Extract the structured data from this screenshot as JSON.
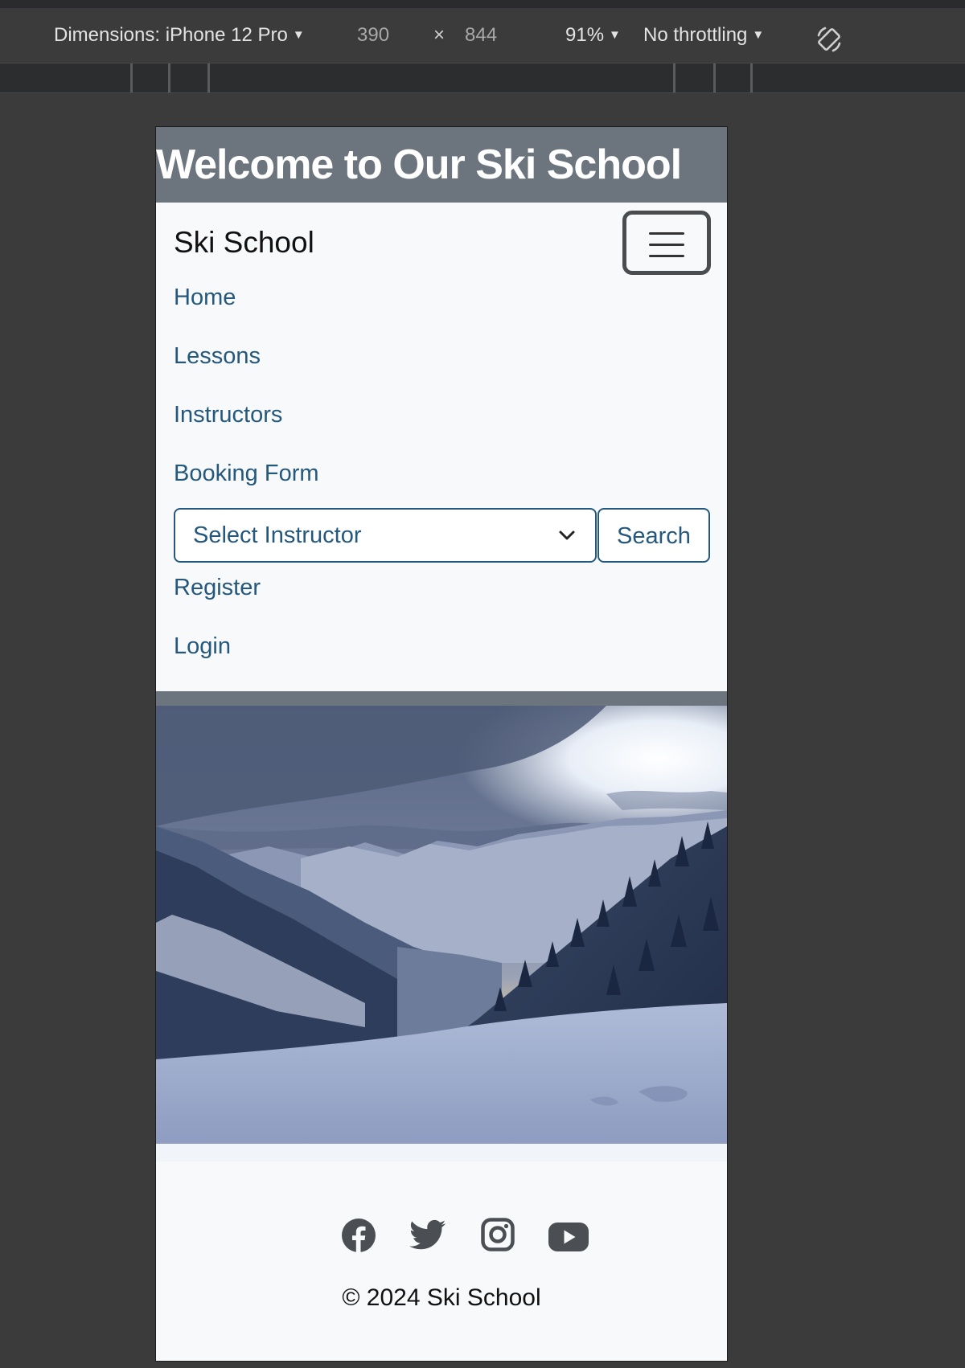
{
  "devtools": {
    "dimensions_label": "Dimensions: iPhone 12 Pro",
    "width": "390",
    "times": "×",
    "height": "844",
    "zoom": "91%",
    "throttling": "No throttling",
    "rotate_icon": "rotate-icon"
  },
  "page": {
    "hero_title": "Welcome to Our Ski School",
    "brand": "Ski School",
    "toggler_icon": "hamburger-menu-icon",
    "nav": [
      "Home",
      "Lessons",
      "Instructors",
      "Booking Form",
      "Register",
      "Login"
    ],
    "instructor_select": "Select Instructor",
    "search_button": "Search",
    "hero_image": "snowy mountain valley landscape photo",
    "social_icons": [
      "facebook-icon",
      "twitter-icon",
      "instagram-icon",
      "youtube-icon"
    ],
    "copyright": "© 2024 Ski School"
  },
  "colors": {
    "link": "#25587d",
    "header_bg": "#6c757d",
    "page_bg": "#f8f9fa",
    "devtools_bg": "#3b3b3b"
  }
}
